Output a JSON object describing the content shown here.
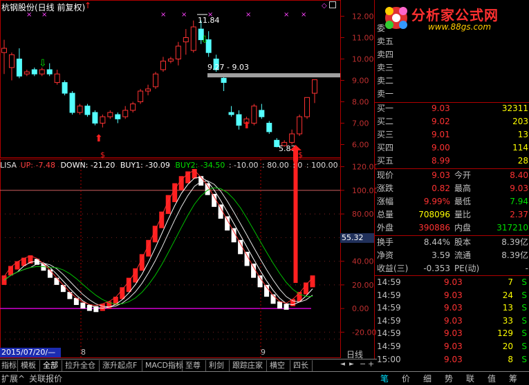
{
  "stock_title": "杭钢股份(日线 前复权)",
  "price_axis": [
    "12.00",
    "11.00",
    "10.00",
    "9.00",
    "8.00",
    "7.00",
    "6.00"
  ],
  "high_label": "11.84",
  "range_label": "9.27 - 9.03",
  "low_label": "5.87",
  "indicator_header": {
    "name": "LISA",
    "up": "UP: -7.48",
    "down": "DOWN: -21.20",
    "buy1": "BUY1: -30.09",
    "buy2": "BUY2: -34.50",
    "extra": [
      ": -10.00",
      ": 80.00",
      ": 0",
      ": 100.00"
    ]
  },
  "indicator_axis": [
    "120.00",
    "100.00",
    "80.00",
    "60.00",
    "40.00",
    "20.00",
    "0.00",
    "-20.00"
  ],
  "cursor_value": "55.32",
  "date_label": "2015/07/20/—",
  "month_labels": [
    "8",
    "9"
  ],
  "period_label": "日线",
  "tabs": [
    "指标",
    "模板",
    "全部",
    "拉升全仓",
    "涨升起点F",
    "MACD指标",
    "至尊",
    "利剑",
    "跟踪庄家",
    "横空",
    "四长"
  ],
  "bottom_tabs": [
    "扩展^",
    "关联报价"
  ],
  "bottom_icons": [
    "笔",
    "价",
    "细",
    "势",
    "联",
    "值",
    "筹"
  ],
  "watermark": {
    "title": "分析家公式网",
    "url": "www.88gs.com"
  },
  "order_book": {
    "wei_label": "委",
    "asks": [
      {
        "label": "卖五",
        "price": "",
        "vol": ""
      },
      {
        "label": "卖四",
        "price": "",
        "vol": ""
      },
      {
        "label": "卖三",
        "price": "",
        "vol": ""
      },
      {
        "label": "卖二",
        "price": "",
        "vol": ""
      },
      {
        "label": "卖一",
        "price": "",
        "vol": ""
      }
    ],
    "bids": [
      {
        "label": "买一",
        "price": "9.03",
        "vol": "32311"
      },
      {
        "label": "买二",
        "price": "9.02",
        "vol": "203"
      },
      {
        "label": "买三",
        "price": "9.01",
        "vol": "13"
      },
      {
        "label": "买四",
        "price": "9.00",
        "vol": "114"
      },
      {
        "label": "买五",
        "price": "8.99",
        "vol": "28"
      }
    ]
  },
  "quote": [
    {
      "l1": "现价",
      "v1": "9.03",
      "l2": "今开",
      "v2": "8.40"
    },
    {
      "l1": "涨跌",
      "v1": "0.82",
      "l2": "最高",
      "v2": "9.03"
    },
    {
      "l1": "涨幅",
      "v1": "9.99%",
      "l2": "最低",
      "v2": "7.94"
    },
    {
      "l1": "总量",
      "v1": "708096",
      "l2": "量比",
      "v2": "2.37"
    },
    {
      "l1": "外盘",
      "v1": "390886",
      "l2": "内盘",
      "v2": "317210"
    }
  ],
  "quote2": [
    {
      "l1": "换手",
      "v1": "8.44%",
      "l2": "股本",
      "v2": "8.39亿"
    },
    {
      "l1": "净资",
      "v1": "3.59",
      "l2": "流通",
      "v2": "8.39亿"
    },
    {
      "l1": "收益(三)",
      "v1": "-0.353",
      "l2": "PE(动)",
      "v2": "-"
    }
  ],
  "ticks": [
    {
      "time": "14:59",
      "price": "9.03",
      "vol": "7",
      "side": "S"
    },
    {
      "time": "14:59",
      "price": "9.03",
      "vol": "24",
      "side": "S"
    },
    {
      "time": "14:59",
      "price": "9.03",
      "vol": "13",
      "side": "S"
    },
    {
      "time": "14:59",
      "price": "9.03",
      "vol": "33",
      "side": "S"
    },
    {
      "time": "14:59",
      "price": "9.03",
      "vol": "129",
      "side": "S"
    },
    {
      "time": "14:59",
      "price": "9.03",
      "vol": "20",
      "side": "S"
    },
    {
      "time": "15:00",
      "price": "9.03",
      "vol": "8",
      "side": "S"
    }
  ],
  "colors": {
    "up": "#ff3232",
    "down": "#54ffff",
    "red_text": "#ff3232",
    "green_text": "#00e000",
    "frame": "#b00000"
  },
  "chart_data": {
    "type": "candlestick",
    "note_free": true,
    "candles": [
      {
        "o": 10.3,
        "c": 10.5,
        "h": 10.9,
        "l": 9.3
      },
      {
        "o": 9.6,
        "c": 10.2,
        "h": 10.3,
        "l": 9.0
      },
      {
        "o": 10.0,
        "c": 9.2,
        "h": 10.5,
        "l": 9.1
      },
      {
        "o": 9.3,
        "c": 9.4,
        "h": 9.5,
        "l": 9.2
      },
      {
        "o": 9.5,
        "c": 9.3,
        "h": 9.6,
        "l": 9.2
      },
      {
        "o": 9.3,
        "c": 9.5,
        "h": 9.6,
        "l": 9.2
      },
      {
        "o": 9.5,
        "c": 9.3,
        "h": 9.8,
        "l": 9.2
      },
      {
        "o": 8.9,
        "c": 9.3,
        "h": 9.5,
        "l": 8.8
      },
      {
        "o": 8.9,
        "c": 8.4,
        "h": 9.0,
        "l": 8.3
      },
      {
        "o": 8.4,
        "c": 7.5,
        "h": 8.5,
        "l": 7.4
      },
      {
        "o": 7.5,
        "c": 7.8,
        "h": 7.9,
        "l": 7.4
      },
      {
        "o": 7.8,
        "c": 7.4,
        "h": 7.9,
        "l": 7.3
      },
      {
        "o": 7.5,
        "c": 7.0,
        "h": 7.6,
        "l": 6.9
      },
      {
        "o": 7.0,
        "c": 7.3,
        "h": 7.4,
        "l": 6.8
      },
      {
        "o": 7.3,
        "c": 7.5,
        "h": 7.6,
        "l": 7.2
      },
      {
        "o": 7.4,
        "c": 7.2,
        "h": 7.5,
        "l": 7.0
      },
      {
        "o": 7.3,
        "c": 7.6,
        "h": 7.8,
        "l": 7.2
      },
      {
        "o": 7.6,
        "c": 7.9,
        "h": 8.0,
        "l": 7.5
      },
      {
        "o": 8.0,
        "c": 8.5,
        "h": 8.6,
        "l": 7.9
      },
      {
        "o": 8.5,
        "c": 8.6,
        "h": 8.8,
        "l": 8.3
      },
      {
        "o": 8.7,
        "c": 9.3,
        "h": 9.4,
        "l": 8.6
      },
      {
        "o": 9.5,
        "c": 9.9,
        "h": 10.1,
        "l": 9.4
      },
      {
        "o": 9.9,
        "c": 10.0,
        "h": 10.1,
        "l": 9.8
      },
      {
        "o": 10.0,
        "c": 10.6,
        "h": 10.8,
        "l": 9.7
      },
      {
        "o": 10.8,
        "c": 11.0,
        "h": 11.4,
        "l": 10.2
      },
      {
        "o": 10.4,
        "c": 11.5,
        "h": 11.8,
        "l": 10.3
      },
      {
        "o": 11.4,
        "c": 10.9,
        "h": 11.8,
        "l": 10.7
      },
      {
        "o": 10.9,
        "c": 10.3,
        "h": 11.3,
        "l": 10.1
      },
      {
        "o": 10.0,
        "c": 9.5,
        "h": 10.2,
        "l": 9.4
      },
      {
        "o": 9.1,
        "c": 8.9,
        "h": 9.2,
        "l": 8.5
      },
      {
        "o": 7.5,
        "c": 7.4,
        "h": 7.8,
        "l": 7.3
      },
      {
        "o": 7.4,
        "c": 6.9,
        "h": 7.6,
        "l": 6.7
      },
      {
        "o": 7.0,
        "c": 7.2,
        "h": 7.3,
        "l": 6.9
      },
      {
        "o": 7.0,
        "c": 7.8,
        "h": 7.9,
        "l": 6.9
      },
      {
        "o": 7.6,
        "c": 7.3,
        "h": 7.9,
        "l": 7.2
      },
      {
        "o": 7.0,
        "c": 6.6,
        "h": 7.1,
        "l": 6.5
      },
      {
        "o": 6.2,
        "c": 5.9,
        "h": 6.3,
        "l": 5.87
      },
      {
        "o": 5.95,
        "c": 6.1,
        "h": 6.2,
        "l": 5.9
      },
      {
        "o": 6.1,
        "c": 6.5,
        "h": 6.7,
        "l": 6.0
      },
      {
        "o": 6.5,
        "c": 7.3,
        "h": 7.4,
        "l": 6.4
      },
      {
        "o": 7.3,
        "c": 8.2,
        "h": 8.2,
        "l": 7.2
      },
      {
        "o": 8.4,
        "c": 9.03,
        "h": 9.03,
        "l": 7.94
      }
    ],
    "price_range": [
      5.5,
      12.5
    ],
    "indicator_range": [
      -25,
      125
    ],
    "indicator_bars": [
      [
        20,
        28
      ],
      [
        28,
        36
      ],
      [
        33,
        40
      ],
      [
        36,
        43
      ],
      [
        38,
        45
      ],
      [
        37,
        42
      ],
      [
        32,
        38
      ],
      [
        26,
        33
      ],
      [
        20,
        26
      ],
      [
        14,
        20
      ],
      [
        8,
        14
      ],
      [
        3,
        9
      ],
      [
        0,
        5
      ],
      [
        -2,
        3
      ],
      [
        -3,
        2
      ],
      [
        -2,
        4
      ],
      [
        0,
        6
      ],
      [
        3,
        10
      ],
      [
        8,
        18
      ],
      [
        14,
        26
      ],
      [
        22,
        34
      ],
      [
        32,
        46
      ],
      [
        44,
        58
      ],
      [
        56,
        70
      ],
      [
        68,
        82
      ],
      [
        80,
        96
      ],
      [
        90,
        106
      ],
      [
        100,
        112
      ],
      [
        106,
        116
      ],
      [
        110,
        118
      ],
      [
        104,
        112
      ],
      [
        96,
        106
      ],
      [
        86,
        97
      ],
      [
        76,
        88
      ],
      [
        66,
        78
      ],
      [
        56,
        68
      ],
      [
        46,
        58
      ],
      [
        36,
        48
      ],
      [
        26,
        38
      ],
      [
        18,
        28
      ],
      [
        10,
        20
      ],
      [
        4,
        12
      ],
      [
        0,
        6
      ],
      [
        -1,
        4
      ],
      [
        2,
        8
      ],
      [
        6,
        14
      ],
      [
        12,
        22
      ],
      [
        18,
        28
      ]
    ]
  }
}
